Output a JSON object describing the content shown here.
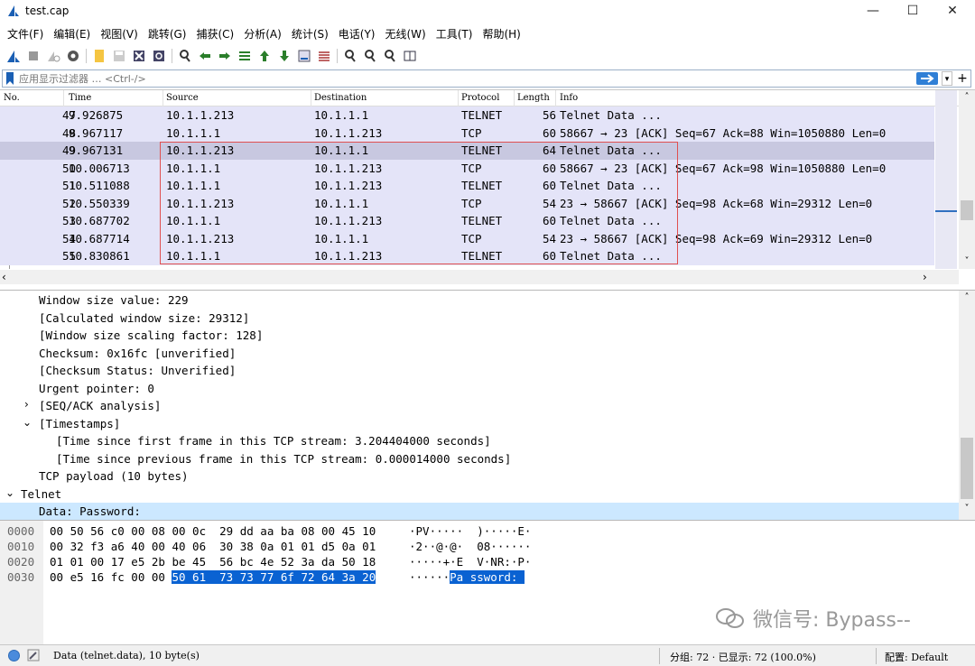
{
  "window": {
    "title": "test.cap"
  },
  "menu": [
    "文件(F)",
    "编辑(E)",
    "视图(V)",
    "跳转(G)",
    "捕获(C)",
    "分析(A)",
    "统计(S)",
    "电话(Y)",
    "无线(W)",
    "工具(T)",
    "帮助(H)"
  ],
  "filter": {
    "placeholder": "应用显示过滤器 … <Ctrl-/>"
  },
  "packet_list": {
    "columns": [
      "No.",
      "Time",
      "Source",
      "Destination",
      "Protocol",
      "Length",
      "Info"
    ],
    "rows": [
      {
        "no": "47",
        "time": "9.926875",
        "src": "10.1.1.213",
        "dst": "10.1.1.1",
        "proto": "TELNET",
        "len": "56",
        "info": "Telnet Data ..."
      },
      {
        "no": "48",
        "time": "9.967117",
        "src": "10.1.1.1",
        "dst": "10.1.1.213",
        "proto": "TCP",
        "len": "60",
        "info": "58667 → 23 [ACK] Seq=67 Ack=88 Win=1050880 Len=0"
      },
      {
        "no": "49",
        "time": "9.967131",
        "src": "10.1.1.213",
        "dst": "10.1.1.1",
        "proto": "TELNET",
        "len": "64",
        "info": "Telnet Data ..."
      },
      {
        "no": "50",
        "time": "10.006713",
        "src": "10.1.1.1",
        "dst": "10.1.1.213",
        "proto": "TCP",
        "len": "60",
        "info": "58667 → 23 [ACK] Seq=67 Ack=98 Win=1050880 Len=0"
      },
      {
        "no": "51",
        "time": "10.511088",
        "src": "10.1.1.1",
        "dst": "10.1.1.213",
        "proto": "TELNET",
        "len": "60",
        "info": "Telnet Data ..."
      },
      {
        "no": "52",
        "time": "10.550339",
        "src": "10.1.1.213",
        "dst": "10.1.1.1",
        "proto": "TCP",
        "len": "54",
        "info": "23 → 58667 [ACK] Seq=98 Ack=68 Win=29312 Len=0"
      },
      {
        "no": "53",
        "time": "10.687702",
        "src": "10.1.1.1",
        "dst": "10.1.1.213",
        "proto": "TELNET",
        "len": "60",
        "info": "Telnet Data ..."
      },
      {
        "no": "54",
        "time": "10.687714",
        "src": "10.1.1.213",
        "dst": "10.1.1.1",
        "proto": "TCP",
        "len": "54",
        "info": "23 → 58667 [ACK] Seq=98 Ack=69 Win=29312 Len=0"
      },
      {
        "no": "55",
        "time": "10.830861",
        "src": "10.1.1.1",
        "dst": "10.1.1.213",
        "proto": "TELNET",
        "len": "60",
        "info": "Telnet Data ..."
      }
    ],
    "selected_row": "49"
  },
  "details": [
    "Window size value: 229",
    "[Calculated window size: 29312]",
    "[Window size scaling factor: 128]",
    "Checksum: 0x16fc [unverified]",
    "[Checksum Status: Unverified]",
    "Urgent pointer: 0",
    "[SEQ/ACK analysis]",
    "[Timestamps]",
    "[Time since first frame in this TCP stream: 3.204404000 seconds]",
    "[Time since previous frame in this TCP stream: 0.000014000 seconds]",
    "TCP payload (10 bytes)",
    "Telnet",
    "Data: Password:"
  ],
  "bytes": [
    {
      "off": "0000",
      "hex": "00 50 56 c0 00 08 00 0c  29 dd aa ba 08 00 45 10",
      "ascii": "·PV·····  )·····E·"
    },
    {
      "off": "0010",
      "hex": "00 32 f3 a6 40 00 40 06  30 38 0a 01 01 d5 0a 01",
      "ascii": "·2··@·@·  08······"
    },
    {
      "off": "0020",
      "hex": "01 01 00 17 e5 2b be 45  56 bc 4e 52 3a da 50 18",
      "ascii": "·····+·E  V·NR:·P·"
    },
    {
      "off": "0030",
      "hex_plain": "00 e5 16 fc 00 00 ",
      "hex_sel": "50 61  73 73 77 6f 72 64 3a 20",
      "ascii_plain": "······",
      "ascii_sel": "Pa ssword: "
    }
  ],
  "watermark": "微信号: Bypass--",
  "status": {
    "field": "Data (telnet.data), 10 byte(s)",
    "counts": "分组: 72 · 已显示: 72 (100.0%)",
    "profile": "配置: Default"
  }
}
